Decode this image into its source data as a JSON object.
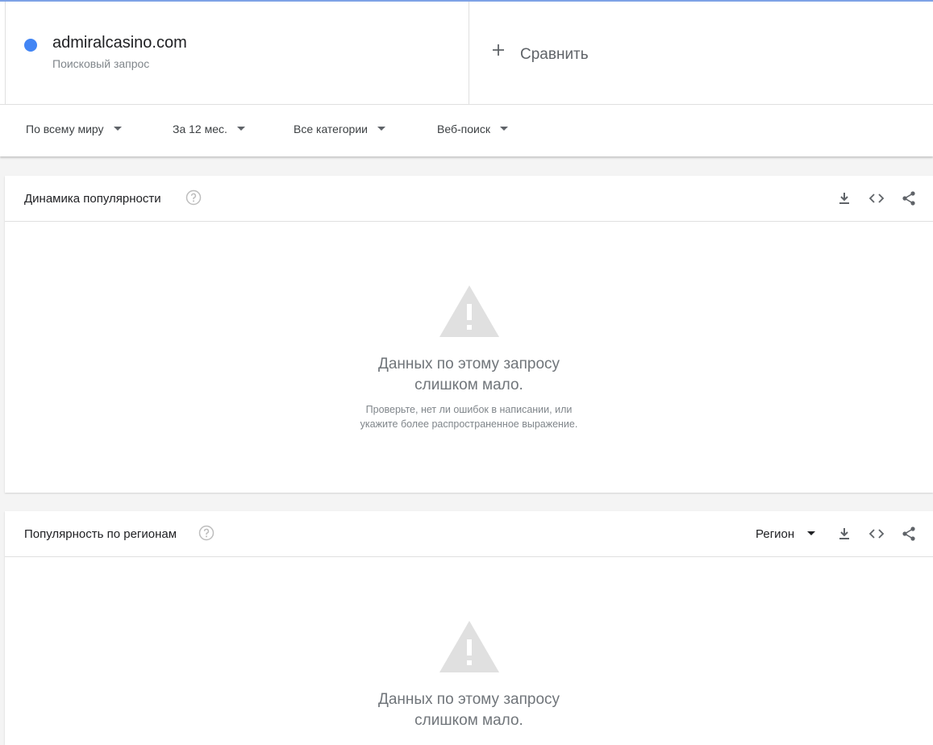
{
  "term": {
    "name": "admiralcasino.com",
    "type": "Поисковый запрос",
    "color": "#4285f4"
  },
  "compare": {
    "label": "Сравнить",
    "icon": "plus-icon"
  },
  "filters": [
    {
      "label": "По всему миру"
    },
    {
      "label": "За 12 мес."
    },
    {
      "label": "Все категории"
    },
    {
      "label": "Веб-поиск"
    }
  ],
  "interest_over_time": {
    "title": "Динамика популярности",
    "icons": [
      "help-icon",
      "download-icon",
      "embed-icon",
      "share-icon"
    ],
    "empty": {
      "title_line1": "Данных по этому запросу",
      "title_line2": "слишком мало.",
      "sub_line1": "Проверьте, нет ли ошибок в написании, или",
      "sub_line2": "укажите более распространенное выражение."
    }
  },
  "interest_by_region": {
    "title": "Популярность по регионам",
    "resolution_label": "Регион",
    "icons": [
      "help-icon",
      "download-icon",
      "embed-icon",
      "share-icon"
    ],
    "empty": {
      "title_line1": "Данных по этому запросу",
      "title_line2": "слишком мало."
    }
  }
}
